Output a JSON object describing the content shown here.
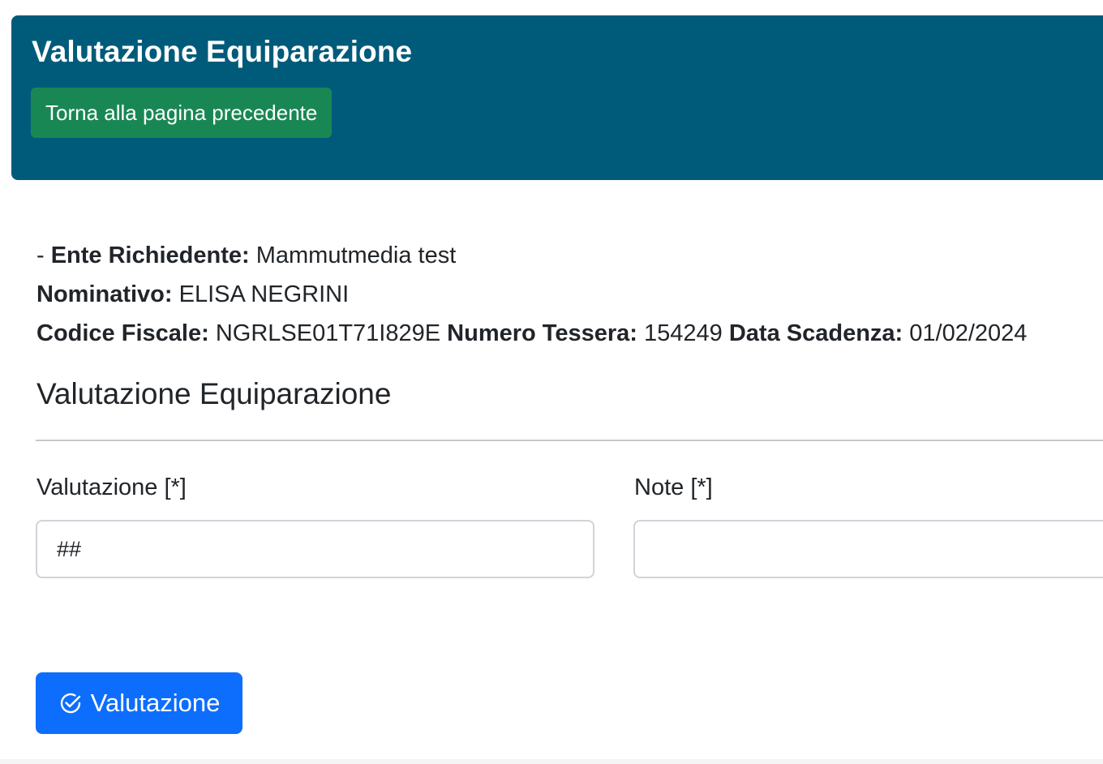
{
  "header": {
    "title": "Valutazione Equiparazione",
    "back_button": "Torna alla pagina precedente"
  },
  "details": {
    "prefix": "- ",
    "ente_label": "Ente Richiedente:",
    "ente_value": "Mammutmedia test",
    "nominativo_label": "Nominativo:",
    "nominativo_value": "ELISA NEGRINI",
    "codice_fiscale_label": "Codice Fiscale:",
    "codice_fiscale_value": "NGRLSE01T71I829E",
    "numero_tessera_label": "Numero Tessera:",
    "numero_tessera_value": "154249",
    "data_scadenza_label": "Data Scadenza:",
    "data_scadenza_value": "01/02/2024"
  },
  "section": {
    "title": "Valutazione Equiparazione"
  },
  "form": {
    "valutazione_label": "Valutazione [*]",
    "valutazione_value": "##",
    "note_label": "Note [*]",
    "note_value": ""
  },
  "submit": {
    "label": "Valutazione",
    "icon": "check-circle-icon"
  },
  "colors": {
    "header_bg": "#005b7b",
    "back_button_bg": "#198754",
    "submit_button_bg": "#0d6efd"
  }
}
